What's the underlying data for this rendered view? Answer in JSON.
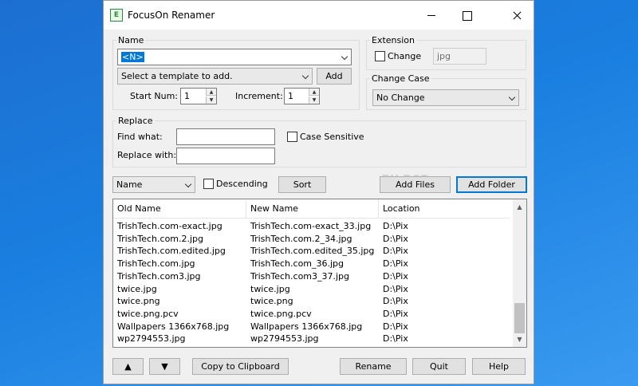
{
  "window": {
    "title": "FocusOn Renamer",
    "icon": "app-icon",
    "icon_glyph": "E"
  },
  "name_group": {
    "label": "Name",
    "name_value": "<N>",
    "template_placeholder": "Select a template to add.",
    "add_label": "Add",
    "start_num_label": "Start Num:",
    "start_num_value": "1",
    "increment_label": "Increment:",
    "increment_value": "1"
  },
  "extension_group": {
    "label": "Extension",
    "change_label": "Change",
    "ext_value": "jpg"
  },
  "case_group": {
    "label": "Change Case",
    "value": "No Change"
  },
  "replace_group": {
    "label": "Replace",
    "find_label": "Find what:",
    "replace_label": "Replace with:",
    "case_sensitive_label": "Case Sensitive",
    "find_value": "",
    "replace_value": ""
  },
  "sort_bar": {
    "sort_field": "Name",
    "descending_label": "Descending",
    "sort_label": "Sort",
    "add_files_label": "Add Files",
    "add_folder_label": "Add Folder"
  },
  "watermark": {
    "text": "FILECR",
    "suffix": ".com"
  },
  "file_list": {
    "columns": [
      "Old Name",
      "New Name",
      "Location"
    ],
    "rows": [
      {
        "old": "TrishTech.com-exact.jpg",
        "new": "TrishTech.com-exact_33.jpg",
        "loc": "D:\\Pix"
      },
      {
        "old": "TrishTech.com.2.jpg",
        "new": "TrishTech.com.2_34.jpg",
        "loc": "D:\\Pix"
      },
      {
        "old": "TrishTech.com.edited.jpg",
        "new": "TrishTech.com.edited_35.jpg",
        "loc": "D:\\Pix"
      },
      {
        "old": "TrishTech.com.jpg",
        "new": "TrishTech.com_36.jpg",
        "loc": "D:\\Pix"
      },
      {
        "old": "TrishTech.com3.jpg",
        "new": "TrishTech.com3_37.jpg",
        "loc": "D:\\Pix"
      },
      {
        "old": "twice.jpg",
        "new": "twice.jpg",
        "loc": "D:\\Pix"
      },
      {
        "old": "twice.png",
        "new": "twice.png",
        "loc": "D:\\Pix"
      },
      {
        "old": "twice.png.pcv",
        "new": "twice.png.pcv",
        "loc": "D:\\Pix"
      },
      {
        "old": "Wallpapers 1366x768.jpg",
        "new": "Wallpapers 1366x768.jpg",
        "loc": "D:\\Pix"
      },
      {
        "old": "wp2794553.jpg",
        "new": "wp2794553.jpg",
        "loc": "D:\\Pix"
      }
    ]
  },
  "bottom_bar": {
    "move_up_label": "▲",
    "move_down_label": "▼",
    "copy_label": "Copy to Clipboard",
    "rename_label": "Rename",
    "quit_label": "Quit",
    "help_label": "Help"
  }
}
